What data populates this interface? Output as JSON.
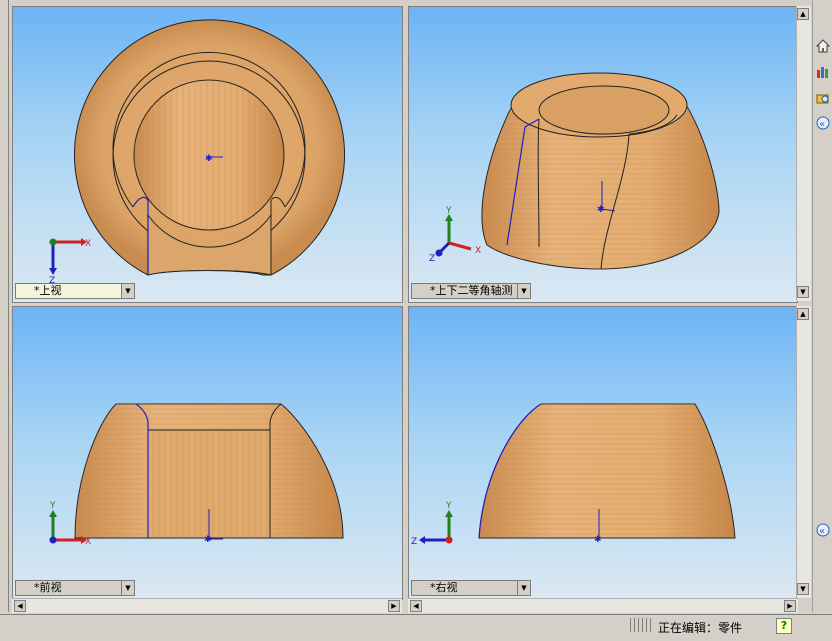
{
  "views": {
    "top_left": {
      "label": "*上视"
    },
    "top_right": {
      "label": "*上下二等角轴测"
    },
    "bottom_left": {
      "label": "*前视"
    },
    "bottom_right": {
      "label": "*右视"
    }
  },
  "axis_labels": {
    "x": "X",
    "y": "Y",
    "z": "Z"
  },
  "status": {
    "text": "正在编辑：零件",
    "help": "?"
  },
  "right_toolbar": [
    "home-icon",
    "palette-icon",
    "search-folder-icon",
    "collapse-icon"
  ],
  "colors": {
    "wood": "#dea46a",
    "edge": "#2020c0",
    "axis_x": "#d02020",
    "axis_y": "#208020",
    "axis_z": "#2020c0"
  }
}
